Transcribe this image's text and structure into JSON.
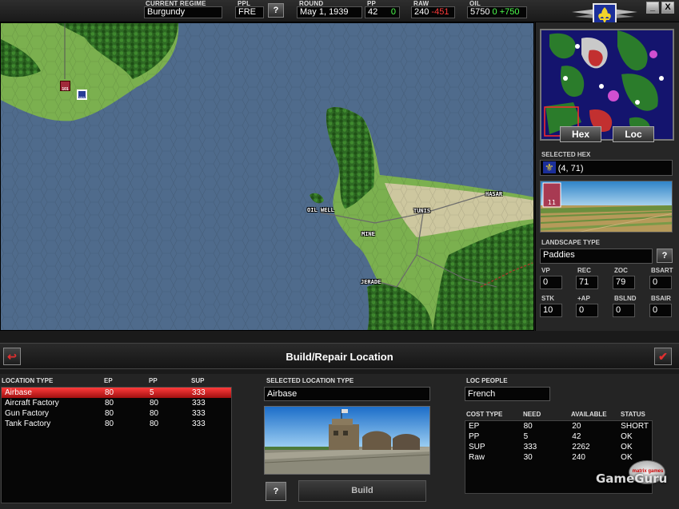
{
  "topbar": {
    "regime_label": "CURRENT REGIME",
    "regime_value": "Burgundy",
    "ppl_label": "PPL",
    "ppl_value": "FRE",
    "help_label": "?",
    "round_label": "ROUND",
    "round_value": "May 1, 1939",
    "pp_label": "PP",
    "pp_value": "42",
    "pp_delta": "0",
    "raw_label": "RAW",
    "raw_value": "240",
    "raw_delta": "-451",
    "oil_label": "OIL",
    "oil_value": "5750",
    "oil_delta_1": "0",
    "oil_delta_2": "+750",
    "minimize": "_",
    "close": "X"
  },
  "map": {
    "cities": [
      "OIL WELL",
      "TUNIS",
      "HASAR",
      "MINE",
      "JERADE"
    ],
    "units": [
      {
        "label": "101"
      },
      {
        "label": "111"
      }
    ]
  },
  "right_panel": {
    "hex_button": "Hex",
    "loc_button": "Loc",
    "selected_hex_label": "SELECTED HEX",
    "selected_hex_value": "(4, 71)",
    "unit_count": "11",
    "landscape_label": "LANDSCAPE TYPE",
    "landscape_value": "Paddies",
    "help_label": "?",
    "stats": [
      {
        "label": "VP",
        "value": "0"
      },
      {
        "label": "REC",
        "value": "71"
      },
      {
        "label": "ZOC",
        "value": "79"
      },
      {
        "label": "BSART",
        "value": "0"
      },
      {
        "label": "STK",
        "value": "10"
      },
      {
        "label": "+AP",
        "value": "0"
      },
      {
        "label": "BSLND",
        "value": "0"
      },
      {
        "label": "BSAIR",
        "value": "0"
      }
    ]
  },
  "build_bar": {
    "title": "Build/Repair Location",
    "back_icon": "↩",
    "confirm_icon": "✔"
  },
  "location_table": {
    "headers": [
      "LOCATION TYPE",
      "EP",
      "PP",
      "SUP"
    ],
    "rows": [
      [
        "Airbase",
        "80",
        "5",
        "333"
      ],
      [
        "Aircraft Factory",
        "80",
        "80",
        "333"
      ],
      [
        "Gun Factory",
        "80",
        "80",
        "333"
      ],
      [
        "Tank Factory",
        "80",
        "80",
        "333"
      ]
    ],
    "selected_index": 0
  },
  "selected_location": {
    "label": "SELECTED LOCATION TYPE",
    "value": "Airbase",
    "help_label": "?",
    "build_label": "Build"
  },
  "loc_people": {
    "label": "LOC PEOPLE",
    "value": "French"
  },
  "cost_table": {
    "headers": [
      "COST TYPE",
      "NEED",
      "AVAILABLE",
      "STATUS"
    ],
    "rows": [
      [
        "EP",
        "80",
        "20",
        "SHORT"
      ],
      [
        "PP",
        "5",
        "42",
        "OK"
      ],
      [
        "SUP",
        "333",
        "2262",
        "OK"
      ],
      [
        "Raw",
        "30",
        "240",
        "OK"
      ]
    ]
  },
  "branding": {
    "logo_text": "matrix games",
    "watermark": "GameGuru"
  },
  "colors": {
    "sea": "#4f6b8c",
    "forest": "#2e6a22",
    "grass": "#7bb04f",
    "desert": "#cdc79f",
    "selection": "#e02828"
  }
}
